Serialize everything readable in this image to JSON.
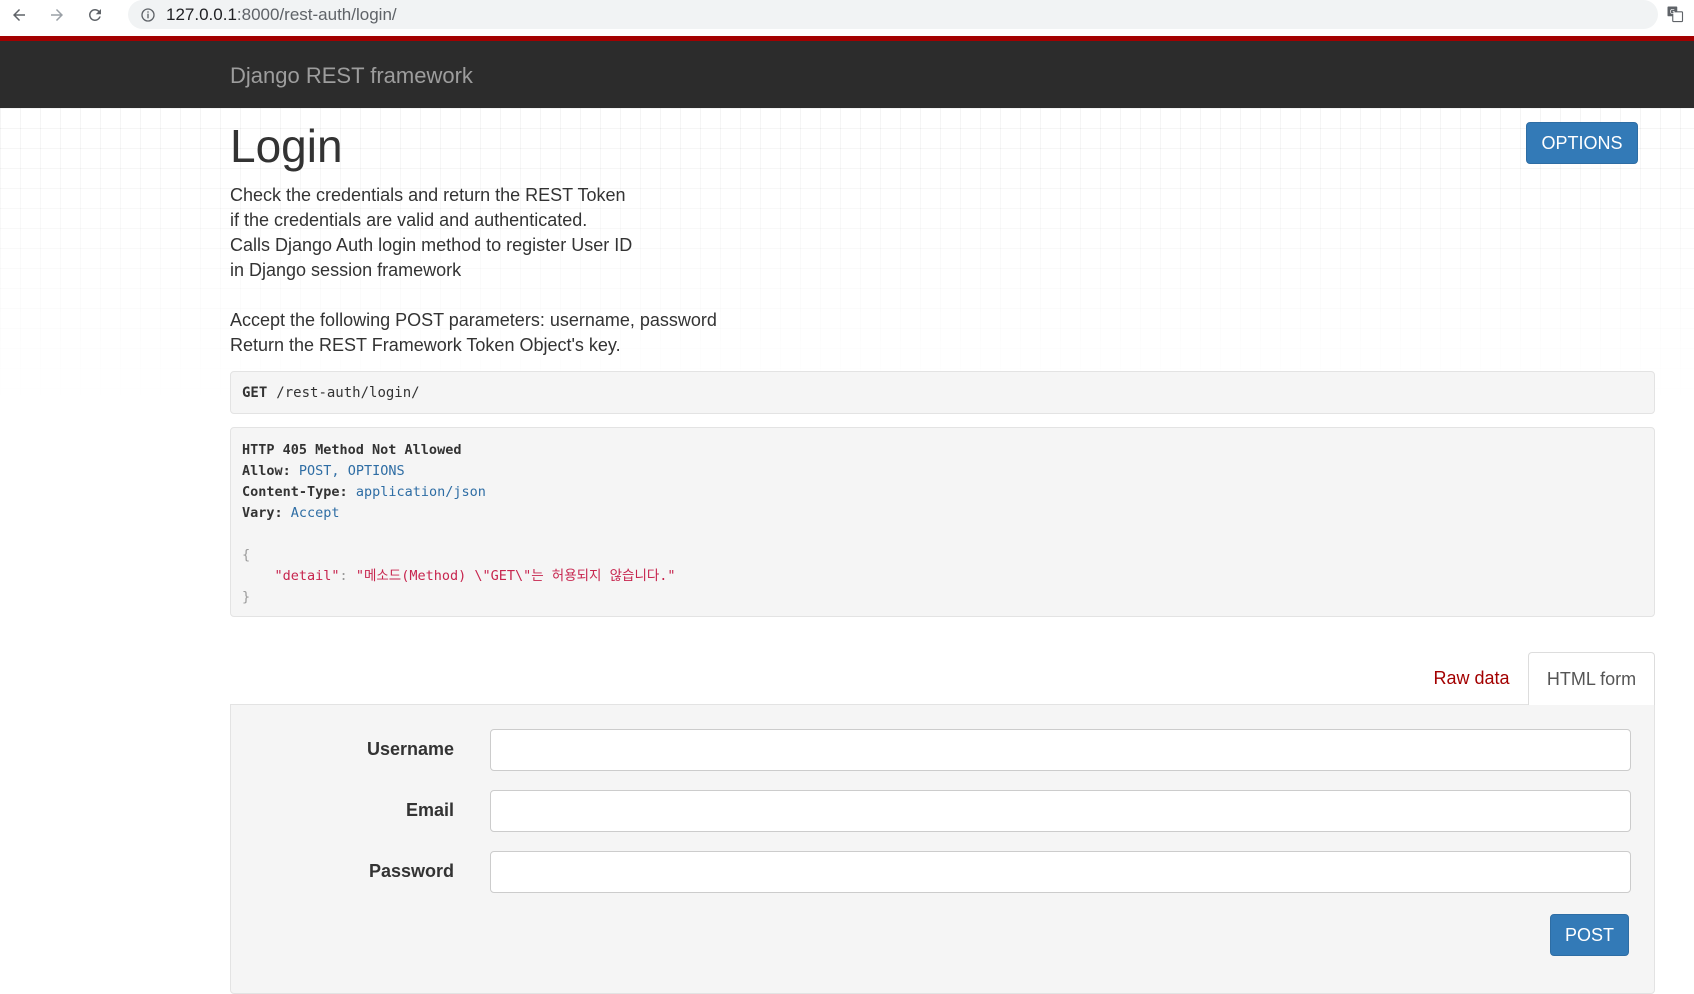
{
  "browser": {
    "url_host": "127.0.0.1",
    "url_path": ":8000/rest-auth/login/"
  },
  "navbar": {
    "brand": "Django REST framework"
  },
  "header": {
    "title": "Login",
    "options_label": "OPTIONS"
  },
  "description": {
    "paragraph1": [
      "Check the credentials and return the REST Token",
      "if the credentials are valid and authenticated.",
      "Calls Django Auth login method to register User ID",
      "in Django session framework"
    ],
    "paragraph2": [
      "Accept the following POST parameters: username, password",
      "Return the REST Framework Token Object's key."
    ]
  },
  "request": {
    "method": "GET",
    "path": "/rest-auth/login/"
  },
  "response": {
    "status": "HTTP 405 Method Not Allowed",
    "headers": [
      {
        "name": "Allow:",
        "value": "POST, OPTIONS"
      },
      {
        "name": "Content-Type:",
        "value": "application/json"
      },
      {
        "name": "Vary:",
        "value": "Accept"
      }
    ],
    "body_open": "{",
    "body_key": "\"detail\"",
    "body_sep": ": ",
    "body_value": "\"메소드(Method) \\\"GET\\\"는 허용되지 않습니다.\"",
    "body_close": "}"
  },
  "tabs": {
    "raw_data": "Raw data",
    "html_form": "HTML form"
  },
  "form": {
    "username_label": "Username",
    "email_label": "Email",
    "password_label": "Password",
    "username_value": "",
    "email_value": "",
    "password_value": "",
    "submit_label": "POST"
  },
  "colors": {
    "accent_red": "#a30000",
    "navbar_bg": "#2c2c2c",
    "button_blue": "#337ab7"
  },
  "icons": [
    "back-arrow-icon",
    "forward-arrow-icon",
    "reload-icon",
    "info-icon",
    "translate-icon"
  ]
}
